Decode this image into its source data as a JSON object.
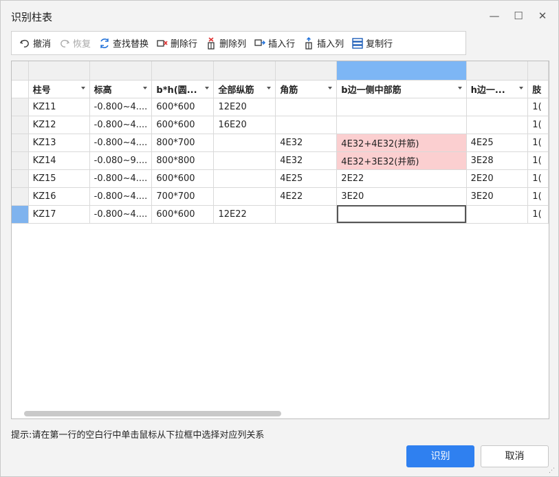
{
  "window": {
    "title": "识别柱表",
    "minimize_glyph": "—",
    "maximize_glyph": "☐",
    "close_glyph": "✕"
  },
  "toolbar": {
    "undo": "撤消",
    "redo": "恢复",
    "find_replace": "查找替换",
    "delete_row": "删除行",
    "delete_col": "删除列",
    "insert_row": "插入行",
    "insert_col": "插入列",
    "copy_row": "复制行"
  },
  "grid": {
    "headers": [
      "柱号",
      "标高",
      "b*h(圆...",
      "全部纵筋",
      "角筋",
      "b边一侧中部筋",
      "h边一...",
      "肢"
    ],
    "rows": [
      [
        "KZ11",
        "-0.800~4....",
        "600*600",
        "12E20",
        "",
        "",
        "",
        "1("
      ],
      [
        "KZ12",
        "-0.800~4....",
        "600*600",
        "16E20",
        "",
        "",
        "",
        "1("
      ],
      [
        "KZ13",
        "-0.800~4....",
        "800*700",
        "",
        "4E32",
        "4E32+4E32(并筋)",
        "4E25",
        "1("
      ],
      [
        "KZ14",
        "-0.080~9....",
        "800*800",
        "",
        "4E32",
        "4E32+3E32(并筋)",
        "3E28",
        "1("
      ],
      [
        "KZ15",
        "-0.800~4....",
        "600*600",
        "",
        "4E25",
        "2E22",
        "2E20",
        "1("
      ],
      [
        "KZ16",
        "-0.800~4....",
        "700*700",
        "",
        "4E22",
        "3E20",
        "3E20",
        "1("
      ],
      [
        "KZ17",
        "-0.800~4....",
        "600*600",
        "12E22",
        "",
        "",
        "",
        "1("
      ]
    ]
  },
  "hint": "提示:请在第一行的空白行中单击鼠标从下拉框中选择对应列关系",
  "buttons": {
    "ok": "识别",
    "cancel": "取消"
  },
  "colors": {
    "selected_column_header": "#7db6f5",
    "highlight_cell": "#fbcfd0",
    "primary_button": "#2f80f0"
  },
  "icons": [
    "undo-icon",
    "redo-icon",
    "find-replace-icon",
    "delete-row-icon",
    "delete-col-icon",
    "insert-row-icon",
    "insert-col-icon",
    "copy-row-icon"
  ]
}
